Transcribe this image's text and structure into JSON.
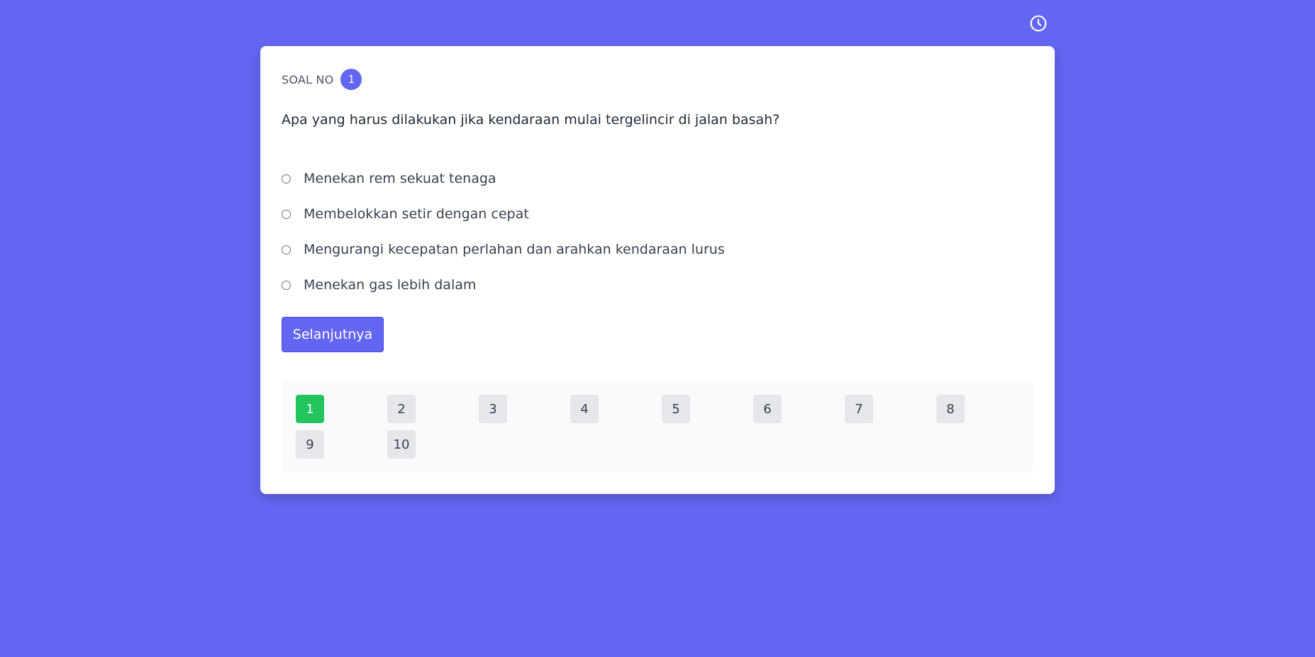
{
  "header": {
    "timer_icon": "clock-icon"
  },
  "question": {
    "label": "SOAL NO",
    "number": "1",
    "text": "Apa yang harus dilakukan jika kendaraan mulai tergelincir di jalan basah?",
    "options": [
      "Menekan rem sekuat tenaga",
      "Membelokkan setir dengan cepat",
      "Mengurangi kecepatan perlahan dan arahkan kendaraan lurus",
      "Menekan gas lebih dalam"
    ]
  },
  "actions": {
    "next_label": "Selanjutnya"
  },
  "navigation": {
    "items": [
      "1",
      "2",
      "3",
      "4",
      "5",
      "6",
      "7",
      "8",
      "9",
      "10"
    ],
    "active": "1"
  },
  "colors": {
    "background": "#6366f1",
    "accent": "#6366f1",
    "active_item": "#22c55e",
    "inactive_item": "#e5e7eb"
  }
}
